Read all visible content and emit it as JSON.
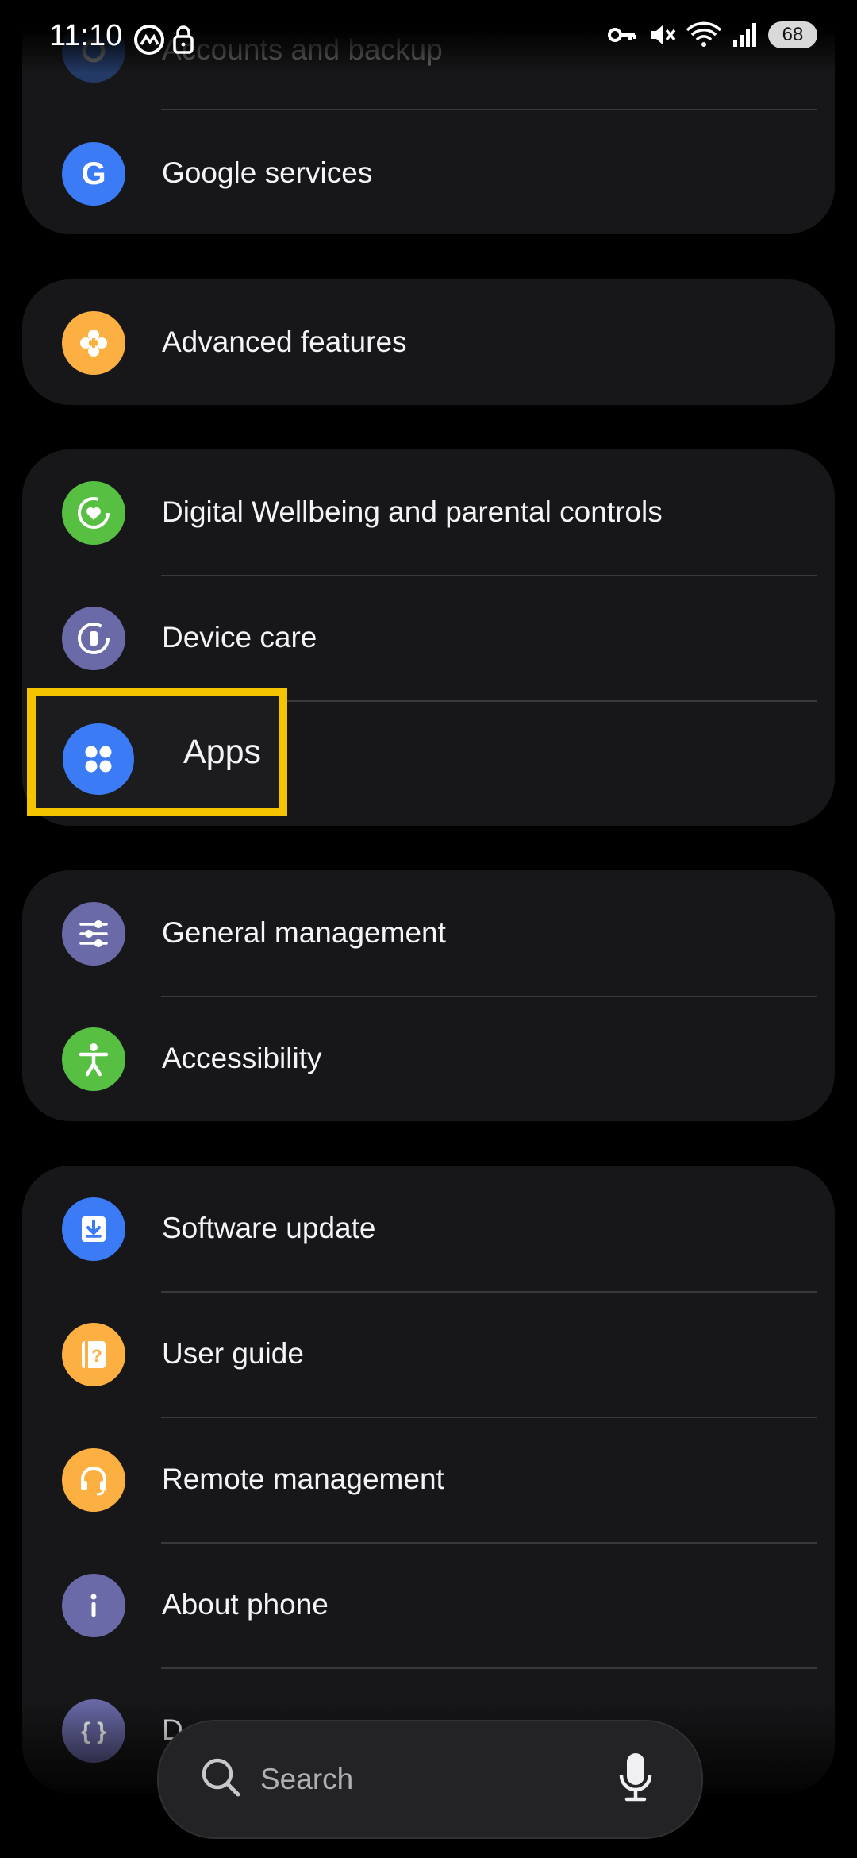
{
  "status_bar": {
    "time": "11:10",
    "battery": "68"
  },
  "groups": [
    {
      "items": [
        {
          "label": "Accounts and backup",
          "icon": "accounts-backup-icon",
          "color": "#3b7cf6"
        },
        {
          "label": "Google services",
          "icon": "google-icon",
          "color": "#3b7cf6"
        }
      ]
    },
    {
      "items": [
        {
          "label": "Advanced features",
          "icon": "advanced-features-icon",
          "color": "#fcb042"
        }
      ]
    },
    {
      "items": [
        {
          "label": "Digital Wellbeing and parental controls",
          "icon": "digital-wellbeing-icon",
          "color": "#57c043"
        },
        {
          "label": "Device care",
          "icon": "device-care-icon",
          "color": "#6a6aa8"
        },
        {
          "label": "Apps",
          "icon": "apps-icon",
          "color": "#3b7cf6"
        }
      ]
    },
    {
      "items": [
        {
          "label": "General management",
          "icon": "general-management-icon",
          "color": "#6a6aa8"
        },
        {
          "label": "Accessibility",
          "icon": "accessibility-icon",
          "color": "#57c043"
        }
      ]
    },
    {
      "items": [
        {
          "label": "Software update",
          "icon": "software-update-icon",
          "color": "#3b7cf6"
        },
        {
          "label": "User guide",
          "icon": "user-guide-icon",
          "color": "#fcb042"
        },
        {
          "label": "Remote management",
          "icon": "remote-management-icon",
          "color": "#fcb042"
        },
        {
          "label": "About phone",
          "icon": "about-phone-icon",
          "color": "#6a6aa8"
        },
        {
          "label": "D",
          "icon": "developer-options-icon",
          "color": "#6a6aa8"
        }
      ]
    }
  ],
  "search": {
    "placeholder": "Search"
  }
}
